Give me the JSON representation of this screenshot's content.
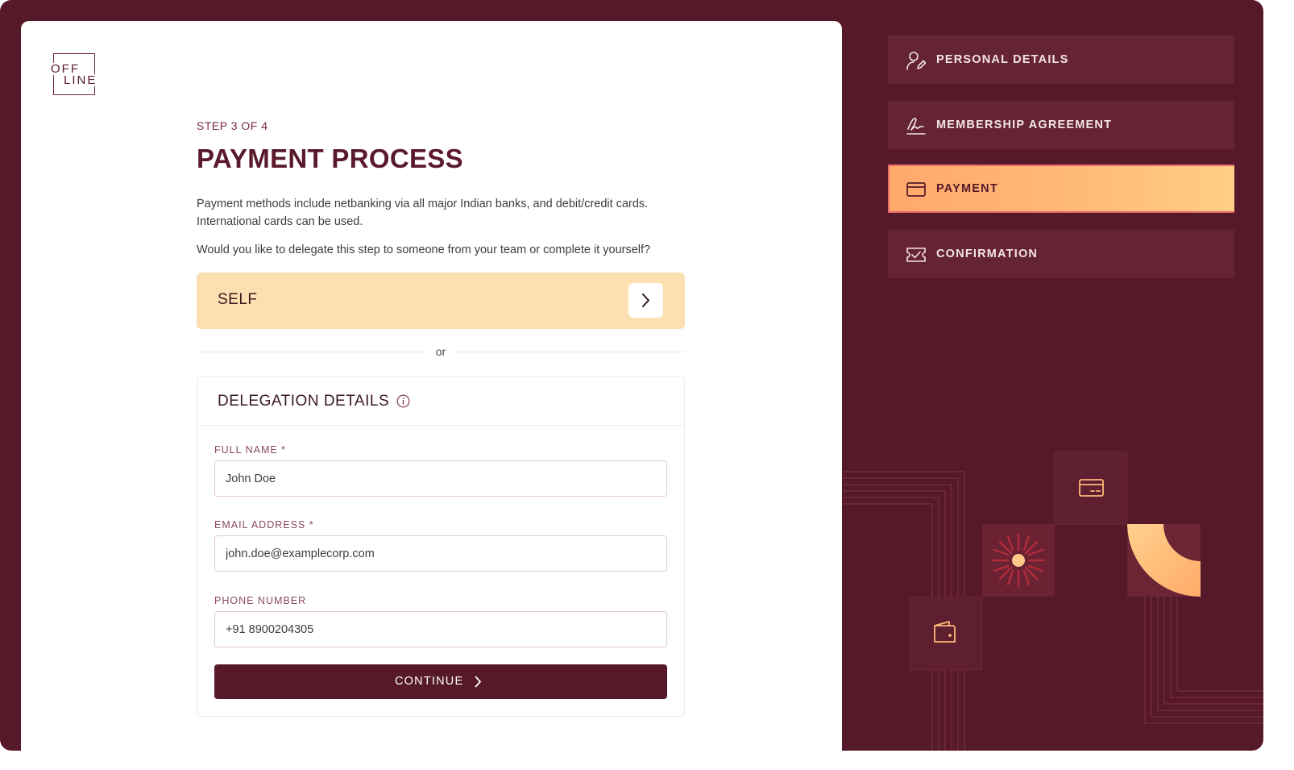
{
  "brand": {
    "logo_line1": "OFF",
    "logo_line2": "LINE"
  },
  "step_indicator": "STEP 3 OF 4",
  "title": "PAYMENT PROCESS",
  "description": "Payment methods include netbanking via all major Indian banks, and debit/credit cards. International cards can be used.",
  "question": "Would you like to delegate this step to someone from your team or complete it yourself?",
  "self_option": {
    "label": "SELF",
    "icon": "chevron-right-icon"
  },
  "divider_text": "or",
  "delegation": {
    "heading": "DELEGATION DETAILS",
    "info_icon": "info-icon",
    "fields": {
      "full_name": {
        "label": "FULL NAME *",
        "value": "John Doe"
      },
      "email": {
        "label": "EMAIL ADDRESS *",
        "value": "john.doe@examplecorp.com"
      },
      "phone": {
        "label": "PHONE NUMBER",
        "value": "+91 8900204305"
      }
    },
    "continue_label": "CONTINUE"
  },
  "steps": [
    {
      "label": "PERSONAL DETAILS",
      "icon": "user-edit-icon",
      "active": false
    },
    {
      "label": "MEMBERSHIP AGREEMENT",
      "icon": "signature-icon",
      "active": false
    },
    {
      "label": "PAYMENT",
      "icon": "credit-card-icon",
      "active": true
    },
    {
      "label": "CONFIRMATION",
      "icon": "ticket-check-icon",
      "active": false
    }
  ],
  "colors": {
    "brand_maroon": "#56192a",
    "accent_orange": "#ffb070",
    "self_background": "#fde0b1"
  }
}
